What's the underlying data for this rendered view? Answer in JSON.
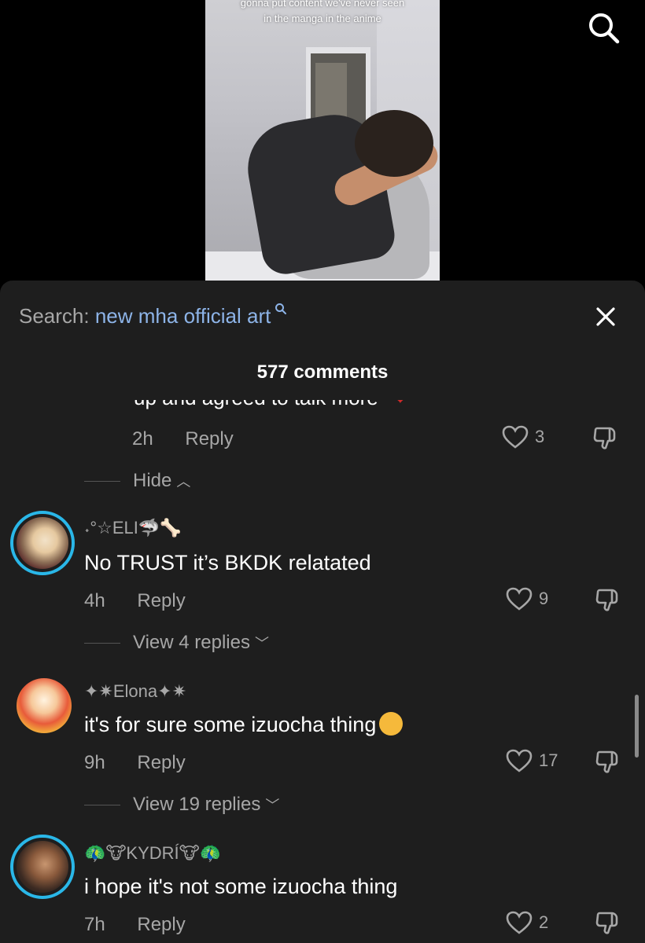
{
  "video": {
    "caption": "gonna put content we've never seen in the manga in the anime"
  },
  "sheet": {
    "search_label": "Search:",
    "search_query": "new mha official art",
    "comment_count": "577 comments"
  },
  "partial_comment": {
    "text": "up and agreed to talk more",
    "time": "2h",
    "reply": "Reply",
    "likes": "3",
    "hide_label": "Hide"
  },
  "comments": [
    {
      "name": "˖°☆ELI🦈🦴",
      "text": "No TRUST it’s BKDK relatated",
      "time": "4h",
      "reply": "Reply",
      "likes": "9",
      "replies_label": "View 4 replies"
    },
    {
      "name": "✦✷Elona✦✷",
      "text": "it's for sure some izuocha thing",
      "time": "9h",
      "reply": "Reply",
      "likes": "17",
      "replies_label": "View 19 replies"
    },
    {
      "name": "🦚🐮KYDRÍ🐮🦚",
      "text": "i hope it's not some izuocha thing",
      "time": "7h",
      "reply": "Reply",
      "likes": "2"
    }
  ],
  "colors": {
    "sheet_bg": "#1e1e1e",
    "link_blue": "#8db4e8",
    "story_ring": "#2ab7e8",
    "muted_text": "#a7a7a7"
  }
}
